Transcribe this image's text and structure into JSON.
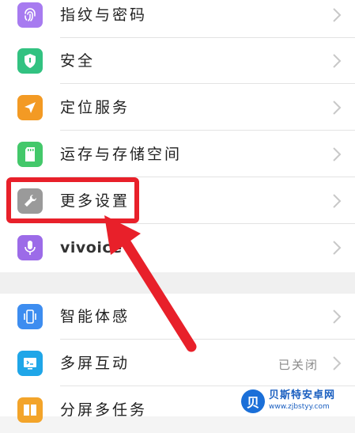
{
  "settings": {
    "items": [
      {
        "label": "指纹与密码",
        "icon": "fingerprint-icon",
        "color": "#a77bf0"
      },
      {
        "label": "安全",
        "icon": "shield-icon",
        "color": "#32c281"
      },
      {
        "label": "定位服务",
        "icon": "location-arrow-icon",
        "color": "#f39a24"
      },
      {
        "label": "运存与存储空间",
        "icon": "storage-card-icon",
        "color": "#43c86a"
      },
      {
        "label": "更多设置",
        "icon": "wrench-icon",
        "color": "#9a9a9a"
      },
      {
        "label": "vivoice",
        "icon": "microphone-icon",
        "color": "#9c6be8"
      }
    ],
    "items2": [
      {
        "label": "智能体感",
        "icon": "phone-motion-icon",
        "color": "#3d8df0"
      },
      {
        "label": "多屏互动",
        "icon": "screen-cast-icon",
        "color": "#1fa6e8",
        "value": "已关闭"
      },
      {
        "label": "分屏多任务",
        "icon": "split-screen-icon",
        "color": "#f3a42a"
      }
    ]
  },
  "annotation": {
    "highlight_color": "#e8202a"
  },
  "watermark": {
    "title": "贝斯特安卓网",
    "url": "www.zjbstyy.com",
    "badge": "贝"
  }
}
